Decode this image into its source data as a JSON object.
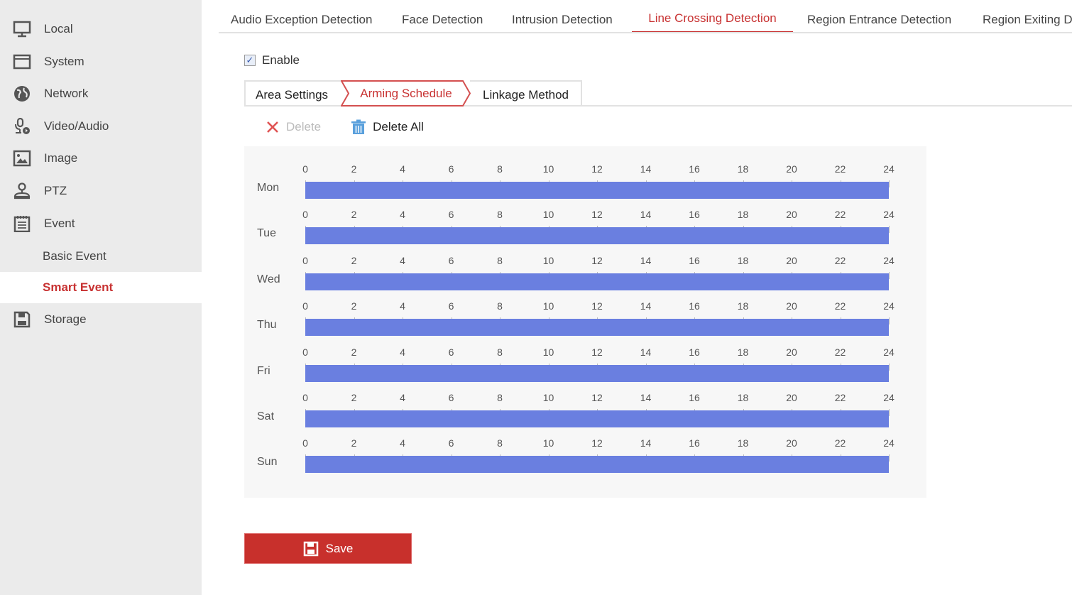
{
  "sidebar": {
    "items": [
      {
        "label": "Local",
        "icon": "monitor-icon"
      },
      {
        "label": "System",
        "icon": "window-icon"
      },
      {
        "label": "Network",
        "icon": "globe-icon"
      },
      {
        "label": "Video/Audio",
        "icon": "microphone-video-icon"
      },
      {
        "label": "Image",
        "icon": "image-icon"
      },
      {
        "label": "PTZ",
        "icon": "ptz-camera-icon"
      },
      {
        "label": "Event",
        "icon": "calendar-icon"
      },
      {
        "label": "Basic Event"
      },
      {
        "label": "Smart Event",
        "active": true
      },
      {
        "label": "Storage",
        "icon": "floppy-disk-icon"
      }
    ]
  },
  "tabs": [
    {
      "label": "Audio Exception Detection"
    },
    {
      "label": "Face Detection"
    },
    {
      "label": "Intrusion Detection"
    },
    {
      "label": "Line Crossing Detection",
      "active": true
    },
    {
      "label": "Region Entrance Detection"
    },
    {
      "label": "Region Exiting Detection"
    }
  ],
  "enable": {
    "label": "Enable",
    "checked": true
  },
  "steps": {
    "area": "Area Settings",
    "arming": "Arming Schedule",
    "linkage": "Linkage Method",
    "active": "Arming Schedule"
  },
  "toolbar": {
    "delete": "Delete",
    "delete_all": "Delete All"
  },
  "schedule": {
    "hour_labels": [
      "0",
      "2",
      "4",
      "6",
      "8",
      "10",
      "12",
      "14",
      "16",
      "18",
      "20",
      "22",
      "24"
    ],
    "days": [
      {
        "day": "Mon",
        "segments": [
          [
            0,
            24
          ]
        ]
      },
      {
        "day": "Tue",
        "segments": [
          [
            0,
            24
          ]
        ]
      },
      {
        "day": "Wed",
        "segments": [
          [
            0,
            24
          ]
        ]
      },
      {
        "day": "Thu",
        "segments": [
          [
            0,
            24
          ]
        ]
      },
      {
        "day": "Fri",
        "segments": [
          [
            0,
            24
          ]
        ]
      },
      {
        "day": "Sat",
        "segments": [
          [
            0,
            24
          ]
        ]
      },
      {
        "day": "Sun",
        "segments": [
          [
            0,
            24
          ]
        ]
      }
    ],
    "bar_color": "#6a7fe0"
  },
  "save_label": "Save",
  "colors": {
    "accent": "#c83232",
    "sidebar": "#ebebeb"
  }
}
